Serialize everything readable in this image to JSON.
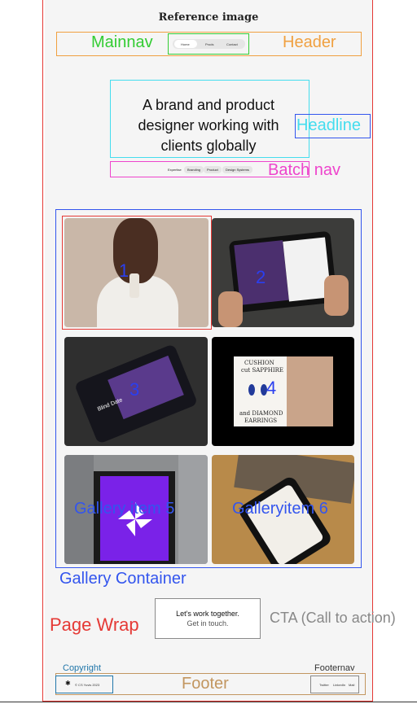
{
  "title": "Reference image",
  "labels": {
    "mainnav": "Mainnav",
    "header": "Header",
    "headline": "Headline",
    "batch_nav": "Batch nav",
    "gallery_container": "Gallery Container",
    "page_wrap": "Page Wrap",
    "cta": "CTA (Call to action)",
    "copyright": "Copyright",
    "footernav": "Footernav",
    "footer": "Footer"
  },
  "mainnav_items": [
    "Home",
    "Prods",
    "Contact"
  ],
  "hero_text": [
    "A brand and product",
    "designer working with",
    "clients globally"
  ],
  "batch_items": [
    "Expertise",
    "Branding",
    "Product",
    "Design Systems"
  ],
  "gallery_numbers": [
    "1",
    "2",
    "3",
    "4"
  ],
  "gallery_items": {
    "item5": "Gallery item 5",
    "item6": "Galleryitem 6"
  },
  "tile3_text": "Blind Date",
  "tile4_text": {
    "l1": "CUSHION",
    "l2": "cut SAPPHIRE",
    "l3": "and DIAMOND",
    "l4": "EARRINGS"
  },
  "cta_lines": [
    "Let's work together.",
    "Get in touch."
  ],
  "copyright_text": "© CS Yuvis 2023",
  "footer_nav": [
    "Twitter",
    "LinkedIn",
    "Mail"
  ],
  "colors": {
    "page_wrap": "#e53935",
    "header": "#f0a040",
    "mainnav": "#33cc33",
    "headline": "#3355ee",
    "headline_box": "#44ddee",
    "batch": "#ee44cc",
    "gallery": "#3355ee",
    "cta_label": "#888888",
    "footer": "#c29660",
    "copyright": "#2277aa"
  }
}
